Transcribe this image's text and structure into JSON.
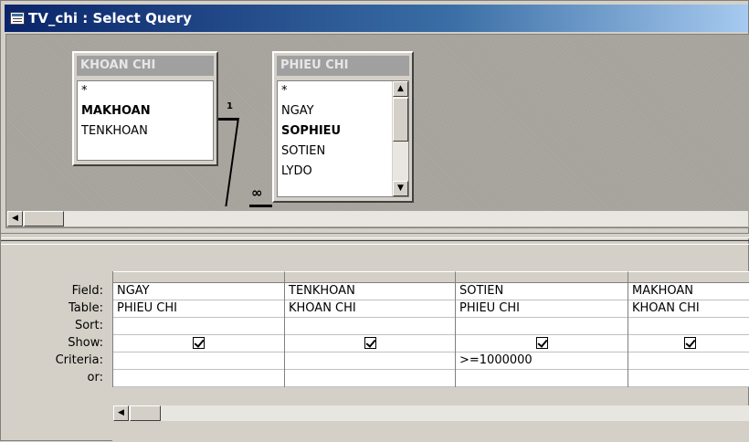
{
  "window": {
    "title": "TV_chi : Select Query"
  },
  "tables": [
    {
      "name": "KHOAN CHI",
      "fields": [
        "*",
        "MAKHOAN",
        "TENKHOAN"
      ],
      "key_field": "MAKHOAN"
    },
    {
      "name": "PHIEU CHI",
      "fields": [
        "*",
        "NGAY",
        "SOPHIEU",
        "SOTIEN",
        "LYDO"
      ],
      "key_field": "SOPHIEU"
    }
  ],
  "relationship": {
    "one_side": "1",
    "many_side": "∞"
  },
  "grid": {
    "row_labels": [
      "Field:",
      "Table:",
      "Sort:",
      "Show:",
      "Criteria:",
      "or:"
    ],
    "columns": [
      {
        "field": "NGAY",
        "table": "PHIEU CHI",
        "sort": "",
        "show": true,
        "criteria": "",
        "or": ""
      },
      {
        "field": "TENKHOAN",
        "table": "KHOAN CHI",
        "sort": "",
        "show": true,
        "criteria": "",
        "or": ""
      },
      {
        "field": "SOTIEN",
        "table": "PHIEU CHI",
        "sort": "",
        "show": true,
        "criteria": ">=1000000",
        "or": ""
      },
      {
        "field": "MAKHOAN",
        "table": "KHOAN CHI",
        "sort": "",
        "show": true,
        "criteria": "",
        "or": ""
      }
    ]
  },
  "icons": {
    "window": "query-window-icon",
    "scroll_up": "scroll-up-arrow-icon",
    "scroll_down": "scroll-down-arrow-icon",
    "scroll_left": "scroll-left-arrow-icon"
  }
}
